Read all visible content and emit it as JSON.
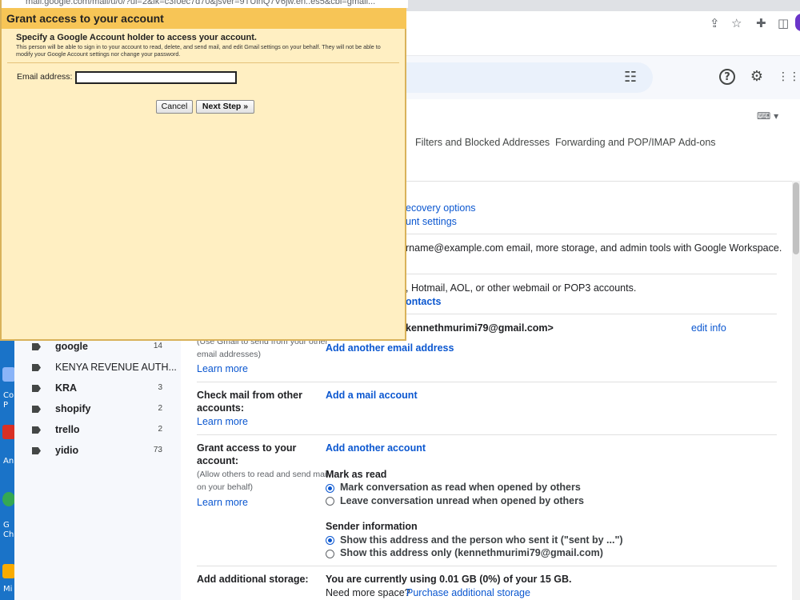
{
  "popup": {
    "url": "mail.google.com/mail/u/0/?ui=2&ik=c3f0ec7d70&jsver=9TUlnQ7V6jw.en..es5&cbl=gmail...",
    "title": "Grant access to your account",
    "heading": "Specify a Google Account holder to access your account.",
    "description": "This person will be able to sign in to your account to read, delete, and send mail, and edit Gmail settings on your behalf. They will not be able to modify your Google Account settings nor change your password.",
    "email_label": "Email address:",
    "email_value": "",
    "cancel_label": "Cancel",
    "next_label": "Next Step »"
  },
  "tabs": [
    "Filters and Blocked Addresses",
    "Forwarding and POP/IMAP",
    "Add-ons"
  ],
  "rows": {
    "recovery_link": "ecovery options",
    "account_settings_link": "unt settings",
    "workspace_text": "rname@example.com email, more storage, and admin tools with Google Workspace.",
    "import_text": ", Hotmail, AOL, or other webmail or POP3 accounts.",
    "contacts_link": "ontacts",
    "send_as_email": "kennethmurimi79@gmail.com>",
    "edit_info": "edit info",
    "send_as_sub1": "(Use Gmail to send from your other",
    "send_as_sub2": "email addresses)",
    "send_as_learn": "Learn more",
    "add_another_email": "Add another email address",
    "check_mail_label1": "Check mail from other",
    "check_mail_label2": "accounts:",
    "check_mail_learn": "Learn more",
    "add_mail_account": "Add a mail account",
    "grant_label1": "Grant access to your",
    "grant_label2": "account:",
    "grant_sub1": "(Allow others to read and send mail",
    "grant_sub2": "on your behalf)",
    "grant_learn": "Learn more",
    "add_another_account": "Add another account",
    "mark_as_read_title": "Mark as read",
    "mark_read_opt1": "Mark conversation as read when opened by others",
    "mark_read_opt2": "Leave conversation unread when opened by others",
    "sender_info_title": "Sender information",
    "sender_opt1": "Show this address and the person who sent it (\"sent by ...\")",
    "sender_opt2": "Show this address only (kennethmurimi79@gmail.com)",
    "storage_label": "Add additional storage:",
    "storage_text": "You are currently using 0.01 GB (0%) of your 15 GB.",
    "storage_need": "Need more space?",
    "storage_link": "Purchase additional storage"
  },
  "sidebar": [
    {
      "name": "google",
      "count": "14",
      "bold": true
    },
    {
      "name": "KENYA REVENUE AUTH...",
      "count": "",
      "bold": false
    },
    {
      "name": "KRA",
      "count": "3",
      "bold": true
    },
    {
      "name": "shopify",
      "count": "2",
      "bold": true
    },
    {
      "name": "trello",
      "count": "2",
      "bold": true
    },
    {
      "name": "yidio",
      "count": "73",
      "bold": true
    }
  ],
  "desktop_labels": [
    "Co",
    "P",
    "An",
    "G",
    "Ch",
    "Mi"
  ],
  "colors": {
    "accent": "#0b57d0",
    "popup_bg": "#ffefc2",
    "popup_title": "#f7c556"
  },
  "icons": [
    "share-icon",
    "star-icon",
    "extensions-icon",
    "sidebar-icon",
    "tune-icon",
    "help-icon",
    "settings-icon",
    "apps-grid-icon",
    "keyboard-icon",
    "label-icon"
  ]
}
